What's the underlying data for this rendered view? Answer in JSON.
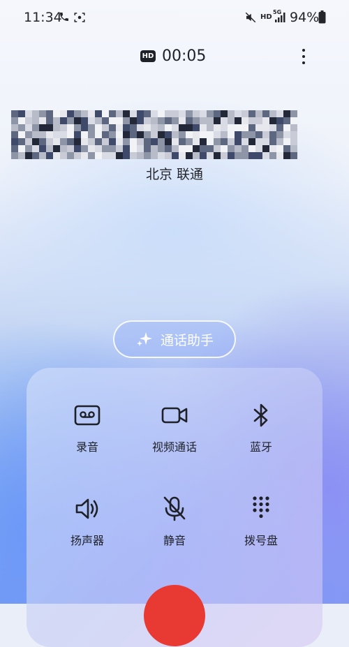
{
  "status_bar": {
    "time": "11:34",
    "left_icons": [
      "phone-call-icon",
      "screen-capture-icon"
    ],
    "right_icons": [
      "mute-icon",
      "hd-voice-icon",
      "5g-signal-icon",
      "battery-icon"
    ],
    "hd_label": "HD",
    "network_label": "5G",
    "battery_percent": "94%"
  },
  "call": {
    "hd_badge": "HD",
    "duration": "00:05",
    "location": "北京 联通"
  },
  "assistant": {
    "label": "通话助手",
    "icon": "sparkle-icon"
  },
  "controls": [
    {
      "label": "录音",
      "icon": "voicemail-record-icon"
    },
    {
      "label": "视频通话",
      "icon": "video-camera-icon"
    },
    {
      "label": "蓝牙",
      "icon": "bluetooth-icon"
    },
    {
      "label": "扬声器",
      "icon": "speaker-icon"
    },
    {
      "label": "静音",
      "icon": "mic-off-icon"
    },
    {
      "label": "拨号盘",
      "icon": "dialpad-icon"
    }
  ],
  "colors": {
    "end_call": "#e83a32",
    "text": "#1f2128"
  }
}
